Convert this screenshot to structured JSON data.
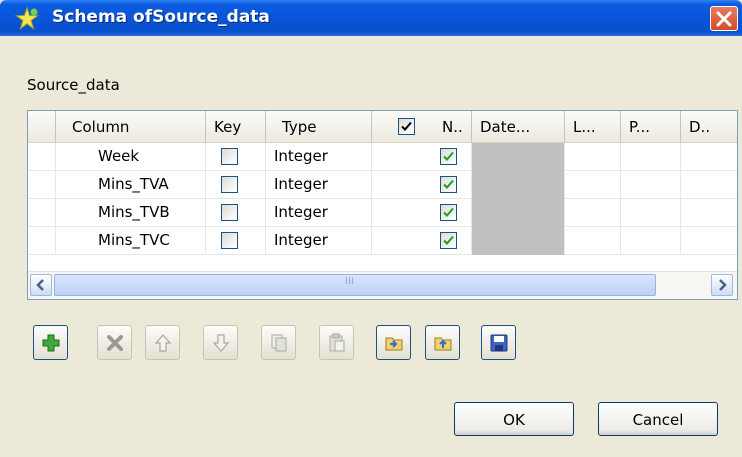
{
  "window": {
    "title": "Schema ofSource_data"
  },
  "schema": {
    "label": "Source_data",
    "columns": [
      "Column",
      "Key",
      "Type",
      "N..",
      "Date...",
      "L...",
      "P...",
      "D.."
    ],
    "rows": [
      {
        "column": "Week",
        "key": false,
        "type": "Integer",
        "nullable": true
      },
      {
        "column": "Mins_TVA",
        "key": false,
        "type": "Integer",
        "nullable": true
      },
      {
        "column": "Mins_TVB",
        "key": false,
        "type": "Integer",
        "nullable": true
      },
      {
        "column": "Mins_TVC",
        "key": false,
        "type": "Integer",
        "nullable": true
      }
    ],
    "header_checkbox_checked": true,
    "scrollbar_grip": "III"
  },
  "toolbar": {
    "buttons": [
      "add-row",
      "remove-row",
      "move-up",
      "move-down",
      "copy",
      "paste",
      "import-schema",
      "export-schema",
      "save-schema"
    ]
  },
  "dialog": {
    "ok_label": "OK",
    "cancel_label": "Cancel"
  },
  "colors": {
    "titlebar": "#0a55d8",
    "close": "#d34c2c",
    "check": "#21a121",
    "grey_cell": "#c0c0c0"
  }
}
